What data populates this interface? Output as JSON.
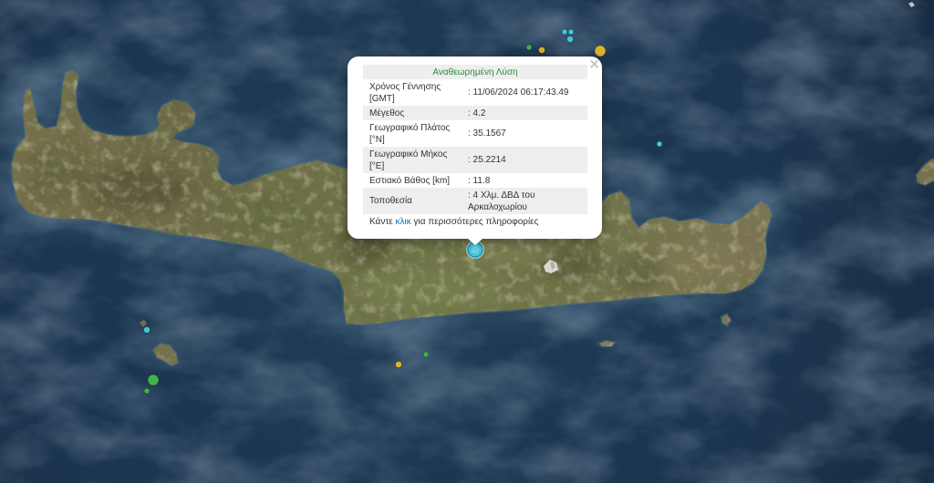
{
  "colors": {
    "marker_cyan": "#45c4da",
    "marker_green": "#3cb44b",
    "marker_yellow": "#d9b62e",
    "popup_title": "#2e8b3a",
    "link": "#0a70b8"
  },
  "popup": {
    "close_label": "×",
    "title": "Αναθεωρημένη Λύση",
    "rows": [
      {
        "label": "Χρόνος Γέννησης [GMT]",
        "value": ": 11/06/2024 06:17:43.49"
      },
      {
        "label": "Μέγεθος",
        "value": ": 4.2"
      },
      {
        "label": "Γεωγραφικό Πλάτος [°N]",
        "value": ": 35.1567"
      },
      {
        "label": "Γεωγραφικό Μήκος [°E]",
        "value": ": 25.2214"
      },
      {
        "label": "Εστιακό Βάθος [km]",
        "value": ": 11.8"
      },
      {
        "label": "Τοποθεσία",
        "value": ": 4 Χλμ. ΔΒΔ του Αρκαλοχωρίου"
      }
    ],
    "footer": {
      "before": "Κάντε ",
      "link": "κλικ",
      "after": " για περισσότερες πληροφορίες"
    }
  }
}
